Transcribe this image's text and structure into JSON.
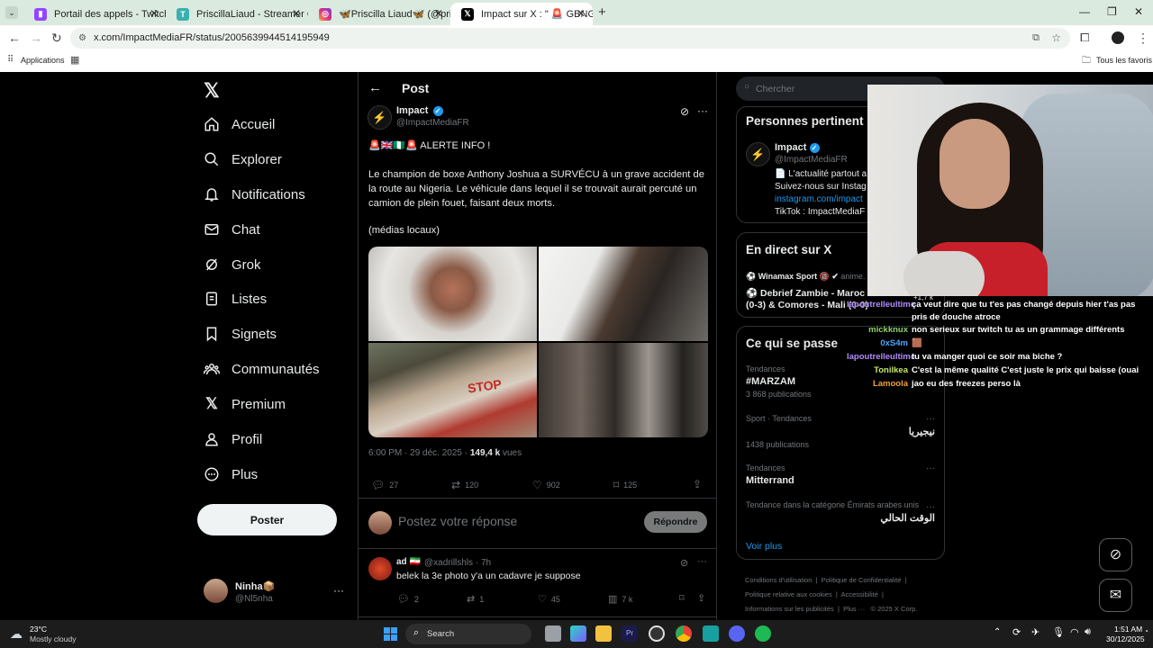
{
  "browser": {
    "tabs": [
      {
        "title": "Portail des appels - Twitch",
        "icon": "twitch-icon",
        "active": false
      },
      {
        "title": "PriscillaLiaud - Streamer Overvi",
        "icon": "tt-icon",
        "active": false
      },
      {
        "title": "🦋Priscilla Liaud🦋 (@priscilla",
        "icon": "instagram-icon",
        "active": false
      },
      {
        "title": "Impact sur X : \" 🚨 GBNG 🚨 ALE",
        "icon": "x-icon",
        "active": true
      }
    ],
    "url": "x.com/ImpactMediaFR/status/2005639944514195949",
    "bookmarks": {
      "apps_label": "Applications",
      "all_label": "Tous les favoris"
    }
  },
  "nav": {
    "items": [
      {
        "label": "Accueil",
        "icon": "home-icon"
      },
      {
        "label": "Explorer",
        "icon": "search-icon"
      },
      {
        "label": "Notifications",
        "icon": "bell-icon"
      },
      {
        "label": "Chat",
        "icon": "mail-icon"
      },
      {
        "label": "Grok",
        "icon": "grok-icon"
      },
      {
        "label": "Listes",
        "icon": "list-icon"
      },
      {
        "label": "Signets",
        "icon": "bookmark-icon"
      },
      {
        "label": "Communautés",
        "icon": "communities-icon"
      },
      {
        "label": "Premium",
        "icon": "x-logo-icon"
      },
      {
        "label": "Profil",
        "icon": "profile-icon"
      },
      {
        "label": "Plus",
        "icon": "more-circle-icon"
      }
    ],
    "post_label": "Poster",
    "account": {
      "name": "Ninha📦",
      "handle": "@Nl5nha"
    }
  },
  "post": {
    "header": "Post",
    "author": {
      "name": "Impact",
      "handle": "@ImpactMediaFR"
    },
    "flags_line": "🚨🇬🇧🇳🇬🚨 ALERTE INFO !",
    "body": "Le champion de boxe Anthony Joshua a SURVÉCU à un grave accident de la route au Nigeria. Le véhicule dans lequel il se trouvait aurait percuté un camion de plein fouet, faisant deux morts.",
    "source": "(médias locaux)",
    "time": "6:00 PM · 29 déc. 2025 · ",
    "views": "149,4 k",
    "views_label": " vues",
    "stats": {
      "replies": "27",
      "reposts": "120",
      "likes": "902",
      "bookmarks": "125"
    },
    "reply_placeholder": "Postez votre réponse",
    "reply_button": "Répondre"
  },
  "reply": {
    "name": "ad 🇮🇷",
    "handle": "@xadrillshls · 7h",
    "text": "belek la 3e photo y'a un cadavre je suppose",
    "stats": {
      "replies": "2",
      "reposts": "1",
      "likes": "45",
      "views": "7 k"
    }
  },
  "right": {
    "search_placeholder": "Chercher",
    "people": {
      "title": "Personnes pertinent",
      "name": "Impact",
      "handle": "@ImpactMediaFR",
      "bio1": "📄 L'actualité partout a",
      "bio2": "Suivez-nous sur Instag",
      "link": "instagram.com/impact",
      "bio3": "TikTok : ImpactMediaF"
    },
    "live": {
      "title": "En direct sur X",
      "host": "⚽ Winamax Sport 🔞 ✔",
      "host_tail": "anime.",
      "event1": "⚽ Debrief Zambie - Maroc",
      "event2": "(0-3) & Comores - Mali (0-0)",
      "count": "+1,7 k"
    },
    "trends": {
      "title": "Ce qui se passe",
      "items": [
        {
          "cat": "Tendances",
          "name": "#MARZAM",
          "count": "3 868 publications"
        },
        {
          "cat": "Sport · Tendances",
          "name": "نيجيريا",
          "count": "1438 publications"
        },
        {
          "cat": "Tendances",
          "name": "Mitterrand",
          "count": ""
        },
        {
          "cat": "Tendance dans la catégorie Émirats arabes unis",
          "name": "الوقت الحالي",
          "count": ""
        }
      ],
      "more": "Voir plus"
    },
    "footer": {
      "l1": "Conditions d'utilisation",
      "l2": "Politique de Confidentialité",
      "l3": "Politique relative aux cookies",
      "l4": "Accessibilité",
      "l5": "Informations sur les publicités",
      "l6": "Plus ···",
      "l7": "© 2025 X Corp."
    }
  },
  "chat": [
    {
      "user": "lapoutrelleultime",
      "color": "#b28cff",
      "msg": "ça veut dire que tu t'es pas changé depuis hier t'as pas pris de douche atroce"
    },
    {
      "user": "mickknux",
      "color": "#8fd16b",
      "msg": "non serieux sur twitch tu as un grammage différents"
    },
    {
      "user": "0xS4m",
      "color": "#4aa6ff",
      "msg": "🟫"
    },
    {
      "user": "lapoutrelleultime",
      "color": "#b28cff",
      "msg": "tu va manger quoi ce soir ma biche ?"
    },
    {
      "user": "Tonilkea",
      "color": "#c7e86a",
      "msg": "C'est la même qualité C'est juste le prix qui baisse (ouai"
    },
    {
      "user": "Lamoola",
      "color": "#f0a23a",
      "msg": "jao eu des freezes perso là"
    }
  ],
  "taskbar": {
    "weather_temp": "23°C",
    "weather_desc": "Mostly cloudy",
    "search_label": "Search",
    "time": "1:51 AM",
    "date": "30/12/2025"
  },
  "colors": {
    "x_blue": "#1d9bf0",
    "x_bg": "#000000",
    "border": "#2f3336",
    "muted": "#71767b"
  }
}
